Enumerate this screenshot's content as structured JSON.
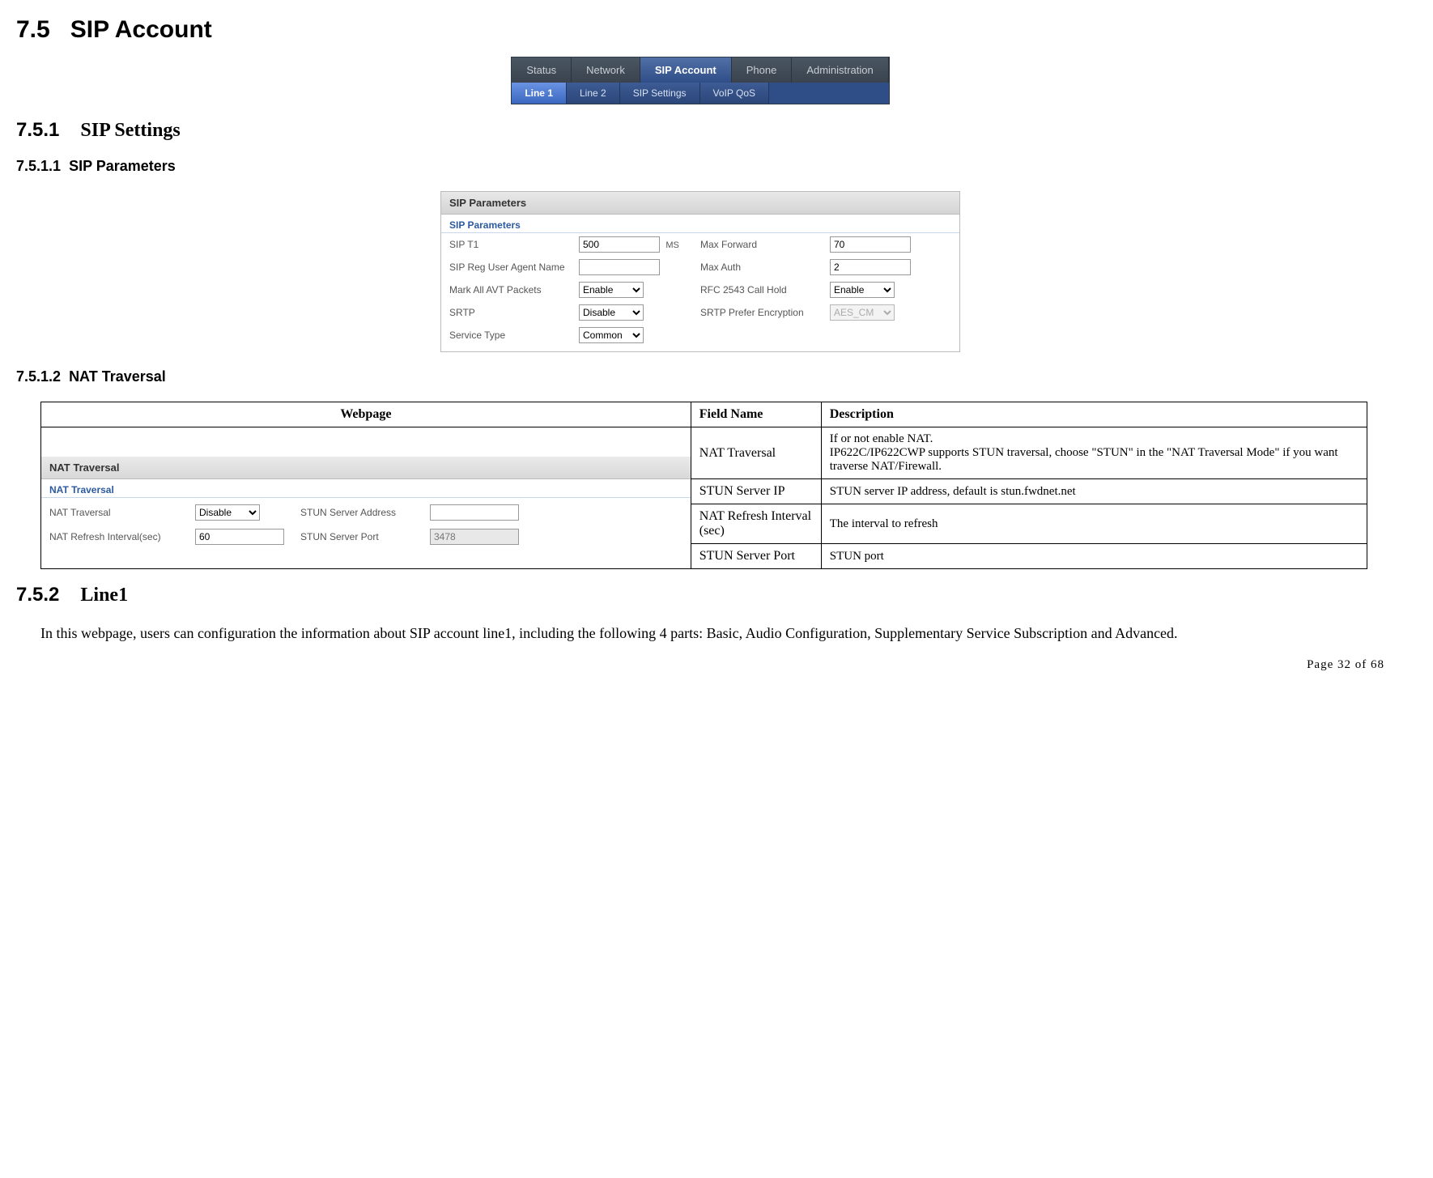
{
  "headings": {
    "h1_num": "7.5",
    "h1_title": "SIP Account",
    "h2a_num": "7.5.1",
    "h2a_title": "SIP Settings",
    "h3a_num": "7.5.1.1",
    "h3a_title": "SIP Parameters",
    "h3b_num": "7.5.1.2",
    "h3b_title": "NAT Traversal",
    "h2b_num": "7.5.2",
    "h2b_title": "Line1"
  },
  "nav": {
    "row1": [
      "Status",
      "Network",
      "SIP Account",
      "Phone",
      "Administration"
    ],
    "row1_active_index": 2,
    "row2": [
      "Line 1",
      "Line 2",
      "SIP Settings",
      "VoIP QoS"
    ],
    "row2_active_index": 0
  },
  "sip_panel": {
    "title": "SIP Parameters",
    "subtitle": "SIP Parameters",
    "fields": {
      "sip_t1_label": "SIP T1",
      "sip_t1_value": "500",
      "sip_t1_unit": "MS",
      "max_forward_label": "Max Forward",
      "max_forward_value": "70",
      "reg_ua_label": "SIP Reg User Agent Name",
      "reg_ua_value": "",
      "max_auth_label": "Max Auth",
      "max_auth_value": "2",
      "mark_avt_label": "Mark All AVT Packets",
      "mark_avt_value": "Enable",
      "rfc_hold_label": "RFC 2543 Call Hold",
      "rfc_hold_value": "Enable",
      "srtp_label": "SRTP",
      "srtp_value": "Disable",
      "srtp_enc_label": "SRTP Prefer Encryption",
      "srtp_enc_value": "AES_CM",
      "service_type_label": "Service Type",
      "service_type_value": "Common"
    }
  },
  "nat_table": {
    "headers": {
      "webpage": "Webpage",
      "field": "Field Name",
      "desc": "Description"
    },
    "webpanel": {
      "title": "NAT Traversal",
      "subtitle": "NAT Traversal",
      "nat_traversal_label": "NAT Traversal",
      "nat_traversal_value": "Disable",
      "stun_addr_label": "STUN Server Address",
      "stun_addr_value": "",
      "nat_refresh_label": "NAT Refresh Interval(sec)",
      "nat_refresh_value": "60",
      "stun_port_label": "STUN Server Port",
      "stun_port_value": "3478"
    },
    "rows": [
      {
        "field": "NAT Traversal",
        "desc": "If or not enable NAT.\nIP622C/IP622CWP supports STUN traversal, choose \"STUN\" in the \"NAT Traversal Mode\" if you want traverse NAT/Firewall."
      },
      {
        "field": "STUN Server IP",
        "desc": "STUN server IP address, default is stun.fwdnet.net"
      },
      {
        "field": "NAT Refresh Interval (sec)",
        "desc": "The interval to refresh"
      },
      {
        "field": "STUN Server Port",
        "desc": "STUN port"
      }
    ]
  },
  "body_paragraph": "In this webpage, users can configuration the information about SIP account line1, including the following 4 parts: Basic, Audio Configuration, Supplementary Service Subscription and Advanced.",
  "footer": "Page 32 of 68"
}
